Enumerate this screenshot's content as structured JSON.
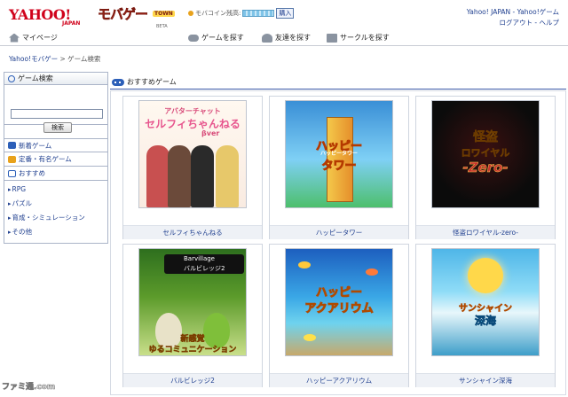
{
  "header": {
    "logo_yahoo": "YAHOO!",
    "logo_yahoo_sub": "JAPAN",
    "logo_mobage": "モバゲー",
    "logo_town": "TOWN",
    "logo_beta": "BETA",
    "coin_label": "モバコイン残高:",
    "coin_buy": "購入",
    "toplinks": {
      "yahoo_japan": "Yahoo! JAPAN",
      "separator": " - ",
      "yahoo_game": "Yahoo!ゲーム",
      "logout": "ログアウト",
      "help": "ヘルプ"
    }
  },
  "nav": {
    "mypage": "マイページ",
    "find_game": "ゲームを探す",
    "find_friend": "友達を探す",
    "find_circle": "サークルを探す"
  },
  "breadcrumb": {
    "home": "Yahoo!モバゲー",
    "separator": " > ",
    "current": "ゲーム検索"
  },
  "sidebar": {
    "search_title": "ゲーム検索",
    "search_input_value": "",
    "search_button": "検索",
    "categories": [
      {
        "label": "新着ゲーム",
        "color": "#2c5fb8"
      },
      {
        "label": "定番・有名ゲーム",
        "color": "#2c5fb8"
      },
      {
        "label": "おすすめ",
        "color": "#2c5fb8"
      }
    ],
    "genres": [
      "RPG",
      "パズル",
      "育成・シミュレーション",
      "その他"
    ]
  },
  "main": {
    "section_title": "おすすめゲーム",
    "games": [
      {
        "name": "セルフィちゃんねる",
        "art_lines": [
          "アバターチャット",
          "セルフィちゃんねる",
          "βver"
        ]
      },
      {
        "name": "ハッピータワー",
        "art_lines": [
          "ハッピー",
          "タワー",
          "ハッピータワー"
        ]
      },
      {
        "name": "怪盗ロワイヤル-zero-",
        "art_lines": [
          "怪盗",
          "ロワイヤル",
          "-Zero-"
        ]
      },
      {
        "name": "バルビレッジ2",
        "art_lines": [
          "Barvillage",
          "バルビレッジ2",
          "新感覚",
          "ゆるコミュニケーション"
        ]
      },
      {
        "name": "ハッピーアクアリウム",
        "art_lines": [
          "ハッピー",
          "アクアリウム"
        ]
      },
      {
        "name": "サンシャイン深海",
        "art_lines": [
          "サンシャイン",
          "深海"
        ]
      }
    ]
  },
  "watermark": "ファミ通.com",
  "icons": {
    "home": "home-icon",
    "game": "controller-icon",
    "friend": "friends-icon",
    "circle": "circle-group-icon",
    "search": "search-icon"
  }
}
